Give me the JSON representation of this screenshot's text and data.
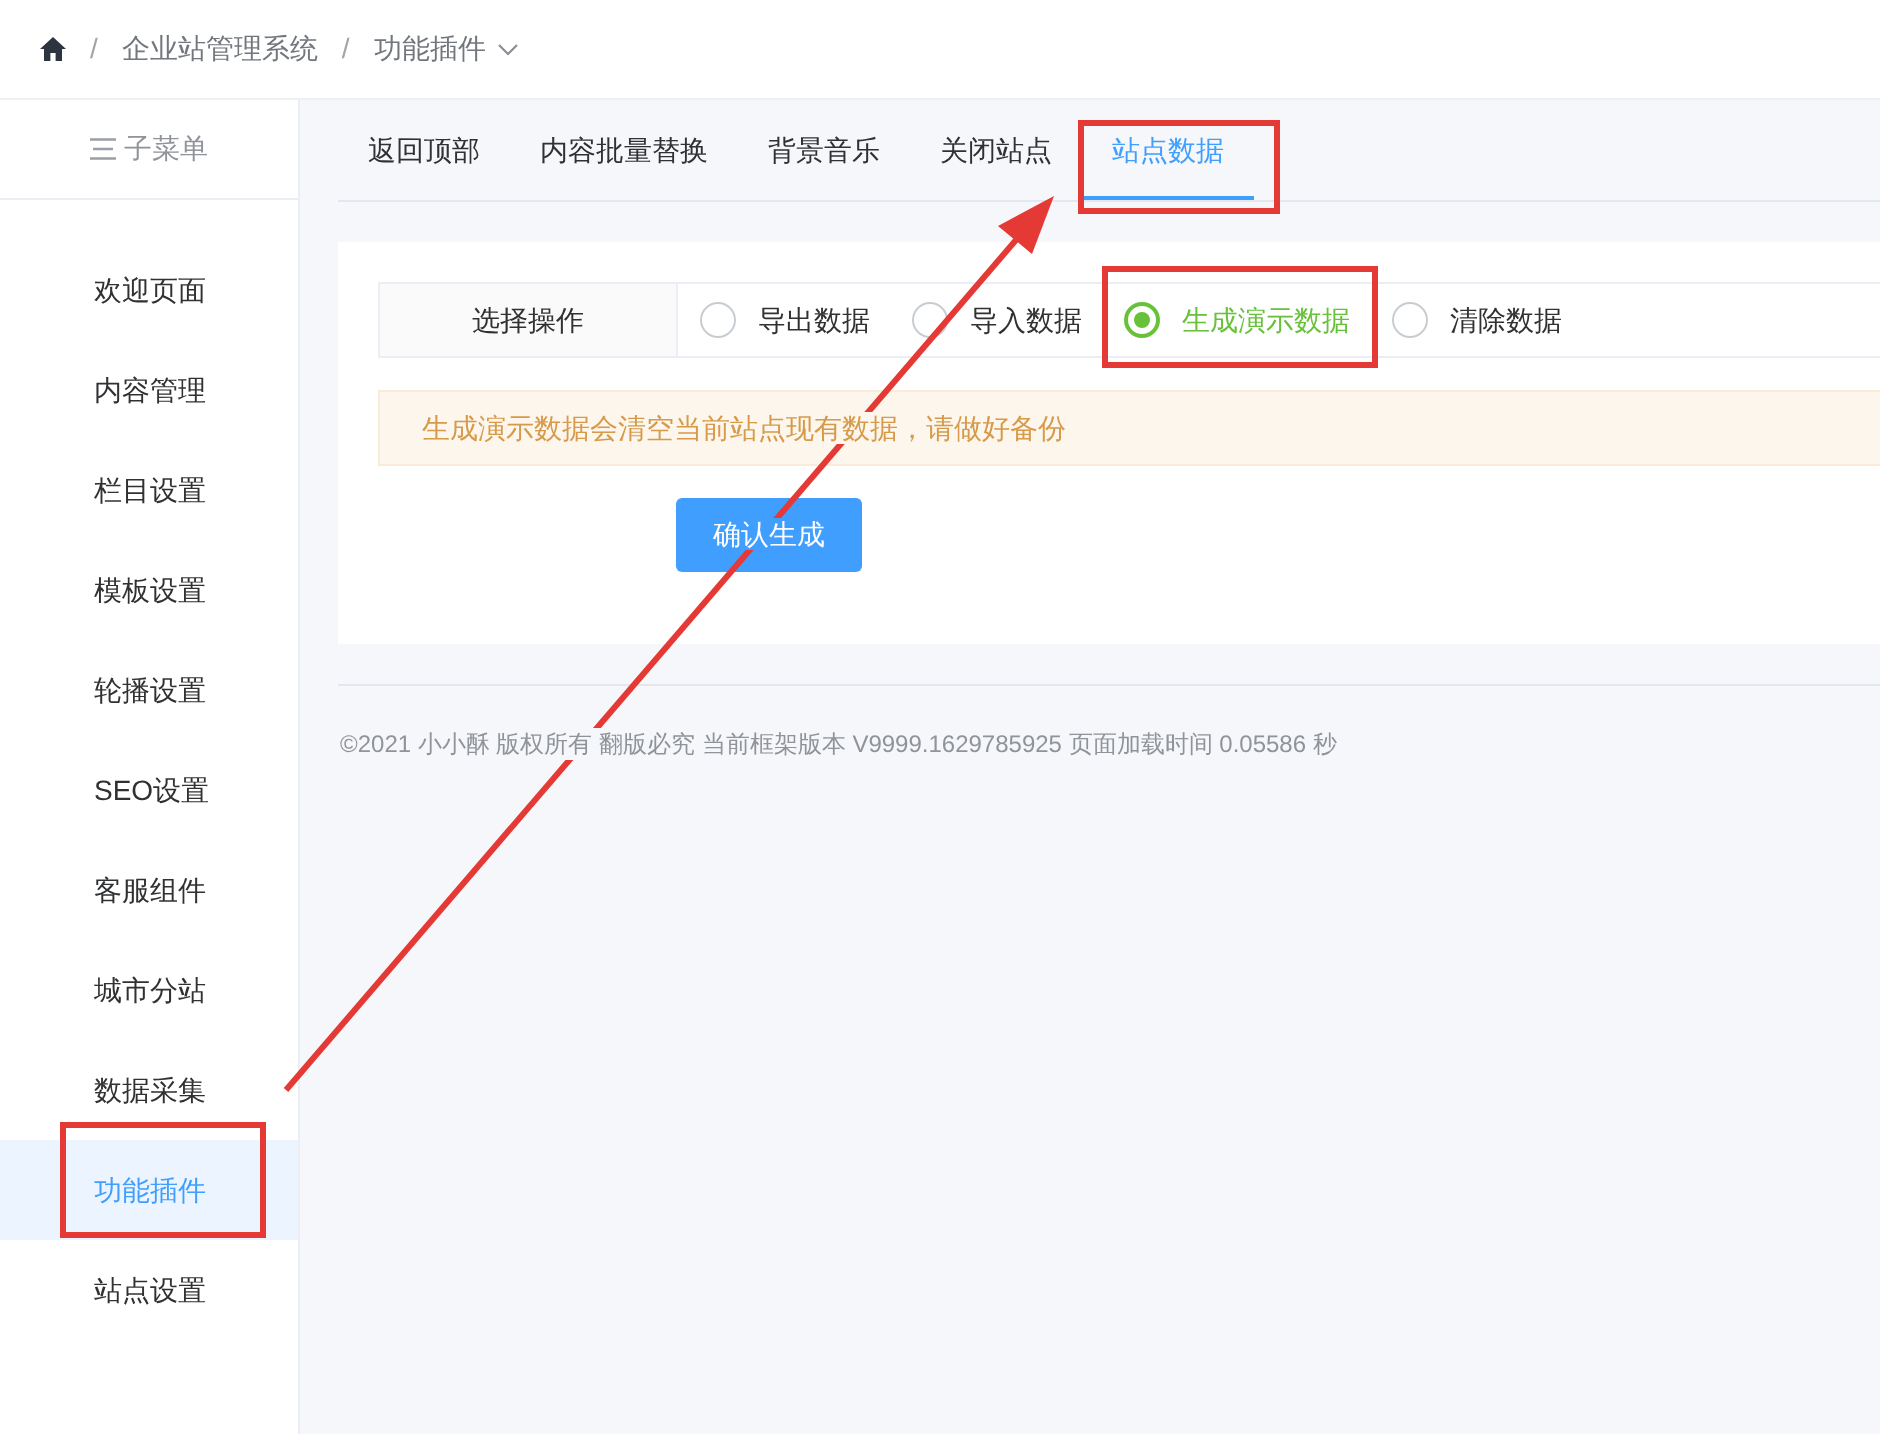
{
  "breadcrumb": {
    "separator": "/",
    "items": [
      {
        "label": "企业站管理系统"
      },
      {
        "label": "功能插件",
        "dropdown": true
      }
    ]
  },
  "sidebar": {
    "title": "子菜单",
    "items": [
      {
        "label": "欢迎页面",
        "selected": false
      },
      {
        "label": "内容管理",
        "selected": false
      },
      {
        "label": "栏目设置",
        "selected": false
      },
      {
        "label": "模板设置",
        "selected": false
      },
      {
        "label": "轮播设置",
        "selected": false
      },
      {
        "label": "SEO设置",
        "selected": false
      },
      {
        "label": "客服组件",
        "selected": false
      },
      {
        "label": "城市分站",
        "selected": false
      },
      {
        "label": "数据采集",
        "selected": false
      },
      {
        "label": "功能插件",
        "selected": true
      },
      {
        "label": "站点设置",
        "selected": false
      }
    ]
  },
  "tabs": [
    {
      "label": "返回顶部",
      "selected": false
    },
    {
      "label": "内容批量替换",
      "selected": false
    },
    {
      "label": "背景音乐",
      "selected": false
    },
    {
      "label": "关闭站点",
      "selected": false
    },
    {
      "label": "站点数据",
      "selected": true
    }
  ],
  "form": {
    "label": "选择操作",
    "options": [
      {
        "label": "导出数据",
        "selected": false
      },
      {
        "label": "导入数据",
        "selected": false
      },
      {
        "label": "生成演示数据",
        "selected": true
      },
      {
        "label": "清除数据",
        "selected": false
      }
    ]
  },
  "alert": {
    "text": "生成演示数据会清空当前站点现有数据，请做好备份"
  },
  "submit_button": {
    "label": "确认生成"
  },
  "footer": {
    "text": "©2021 小小酥 版权所有 翻版必究 当前框架版本 V9999.1629785925 页面加载时间 0.05586 秒"
  }
}
